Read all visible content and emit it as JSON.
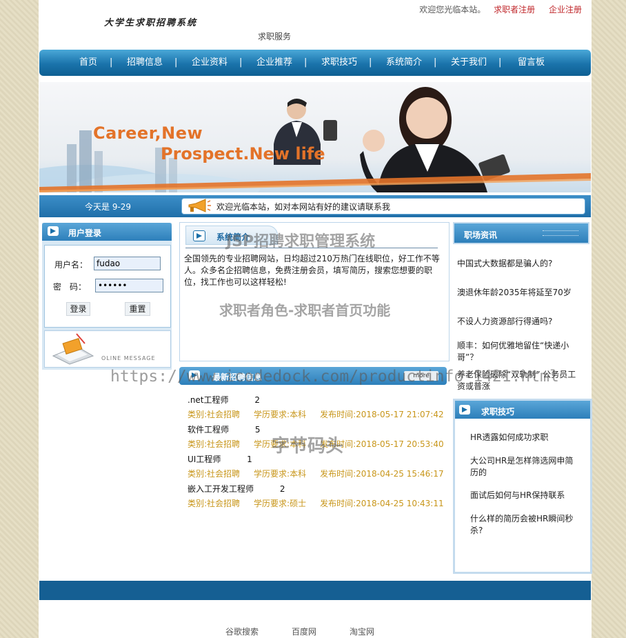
{
  "header": {
    "logo_text": "大学生求职招聘系统",
    "subtitle": "求职服务",
    "welcome": "欢迎您光临本站。",
    "register_seeker": "求职者注册",
    "register_company": "企业注册"
  },
  "nav": {
    "items": [
      "首页",
      "招聘信息",
      "企业资料",
      "企业推荐",
      "求职技巧",
      "系统简介",
      "关于我们",
      "留言板"
    ],
    "separator": "|"
  },
  "banner": {
    "line1": "Career,New",
    "line2": "Prospect.New life"
  },
  "ticker": {
    "date": "今天是 9-29",
    "message": "欢迎光临本站，如对本网站有好的建议请联系我"
  },
  "login": {
    "title": "用户登录",
    "username_label": "用户名：",
    "username_value": "fudao",
    "password_label": "密　码：",
    "password_value": "••••••",
    "login_button": "登录",
    "reset_button": "重置",
    "ad_caption": "OLINE MESSAGE"
  },
  "intro": {
    "title": "系统简介",
    "text": "全国领先的专业招聘网站，日均超过210万热门在线职位，好工作不等人。众多名企招聘信息，免费注册会员，填写简历，搜索您想要的职位，找工作也可以这样轻松!"
  },
  "jobs": {
    "title": "最新招聘信息",
    "more": "more",
    "list": [
      {
        "name": ".net工程师",
        "count": "2",
        "type": "类别:社会招聘",
        "edu": "学历要求:本科",
        "time": "发布时间:2018-05-17 21:07:42"
      },
      {
        "name": "软件工程师",
        "count": "5",
        "type": "类别:社会招聘",
        "edu": "学历要求:本科",
        "time": "发布时间:2018-05-17 20:53:40"
      },
      {
        "name": "UI工程师",
        "count": "1",
        "type": "类别:社会招聘",
        "edu": "学历要求:本科",
        "time": "发布时间:2018-04-25 15:46:17"
      },
      {
        "name": "嵌入工开发工程师",
        "count": "2",
        "type": "类别:社会招聘",
        "edu": "学历要求:硕士",
        "time": "发布时间:2018-04-25 10:43:11"
      }
    ]
  },
  "news": {
    "title": "职场资讯",
    "items": [
      "中国式大数据都是骗人的?",
      "澳退休年龄2035年将延至70岁",
      "不设人力资源部行得通吗?",
      "顺丰：如何优雅地留住“快递小哥”？",
      "养老保险破除“双轨制” 公务员工资或普涨"
    ]
  },
  "tips": {
    "title": "求职技巧",
    "items": [
      "HR透露如何成功求职",
      "大公司HR是怎样筛选网申简历的",
      "面试后如何与HR保持联系",
      "什么样的简历会被HR瞬间秒杀?"
    ]
  },
  "footer": {
    "links": [
      "谷歌搜索",
      "百度网",
      "淘宝网"
    ]
  },
  "watermarks": {
    "system": "JSP招聘求职管理系统",
    "role": "求职者角色-求职者首页功能",
    "url": "https://www.icodedock.com/productinfo-1421.html",
    "brand": "字节码头"
  },
  "colors": {
    "nav_blue": "#1a73ab",
    "link_red": "#c0282c",
    "meta_gold": "#c8961a",
    "footer_blue": "#155f93"
  }
}
